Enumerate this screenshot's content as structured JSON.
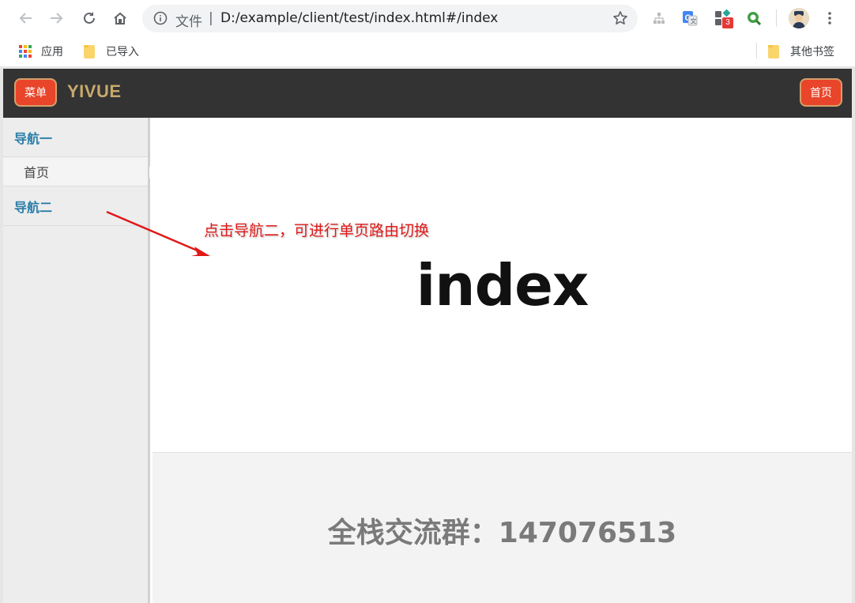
{
  "browser": {
    "url_prefix": "文件",
    "url_separator": "|",
    "url": "D:/example/client/test/index.html#/index",
    "extension_badge": "3",
    "icons": [
      "back-icon",
      "forward-icon",
      "reload-icon",
      "home-icon",
      "info-icon",
      "star-icon",
      "sitemap-icon",
      "translate-icon",
      "extensions-icon",
      "search-ext-icon",
      "avatar",
      "more-icon"
    ]
  },
  "bookmarks": {
    "apps": "应用",
    "imported": "已导入",
    "other": "其他书签"
  },
  "header": {
    "menu_label": "菜单",
    "logo": "YIVUE",
    "home_label": "首页"
  },
  "sidebar": {
    "groups": [
      {
        "label": "导航一",
        "items": [
          {
            "label": "首页",
            "active": true
          }
        ]
      },
      {
        "label": "导航二",
        "items": []
      }
    ]
  },
  "main": {
    "heading": "index"
  },
  "footer": {
    "text": "全栈交流群：147076513"
  },
  "annotation": {
    "text": "点击导航二，可进行单页路由切换"
  },
  "colors": {
    "header_bg": "#333333",
    "accent_button": "#e8452a",
    "logo": "#c8a96b",
    "nav_group": "#2b7ea8",
    "annotation": "#e01818"
  }
}
